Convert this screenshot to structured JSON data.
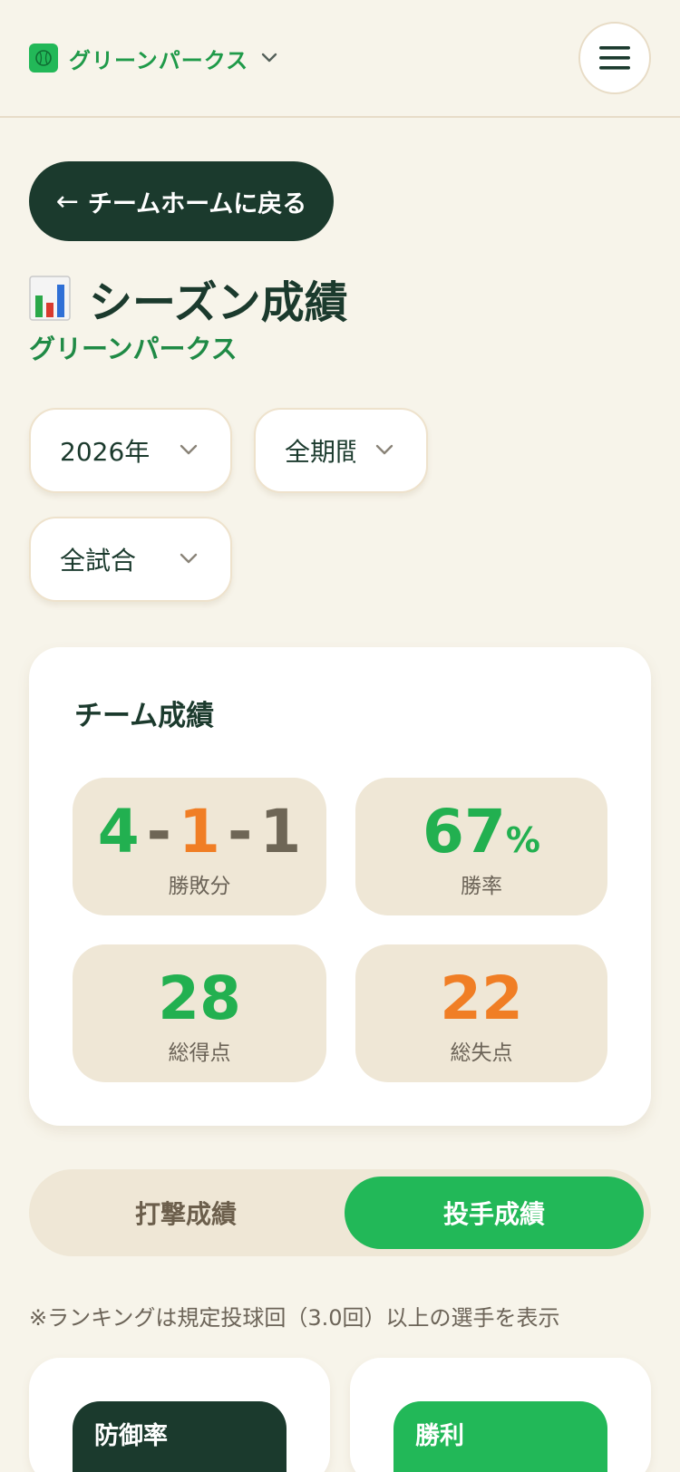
{
  "header": {
    "team_name": "グリーンパークス",
    "logo_icon": "baseball-icon",
    "menu_icon": "hamburger-menu-icon"
  },
  "back_button": {
    "arrow": "←",
    "label": "チームホームに戻る"
  },
  "page": {
    "title_icon": "bar-chart-icon",
    "title": "シーズン成績",
    "subtitle": "グリーンパークス"
  },
  "filters": {
    "year": "2026年",
    "period": "全期間",
    "games": "全試合"
  },
  "team_stats": {
    "title": "チーム成績",
    "record": {
      "wins": "4",
      "losses": "1",
      "draws": "1",
      "dash": "-",
      "label": "勝敗分"
    },
    "win_rate": {
      "value": "67",
      "unit": "%",
      "label": "勝率"
    },
    "runs_scored": {
      "value": "28",
      "label": "総得点"
    },
    "runs_allowed": {
      "value": "22",
      "label": "総失点"
    }
  },
  "tabs": {
    "batting": "打撃成績",
    "pitching": "投手成績",
    "active": "pitching"
  },
  "note": "※ランキングは規定投球回（3.0回）以上の選手を表示",
  "rankings": [
    {
      "title": "防御率"
    },
    {
      "title": "勝利"
    }
  ],
  "colors": {
    "background": "#f7f4ea",
    "dark_green": "#1b3a2d",
    "accent_green": "#22b858",
    "orange": "#f07e25",
    "tile": "#efe7d6"
  }
}
